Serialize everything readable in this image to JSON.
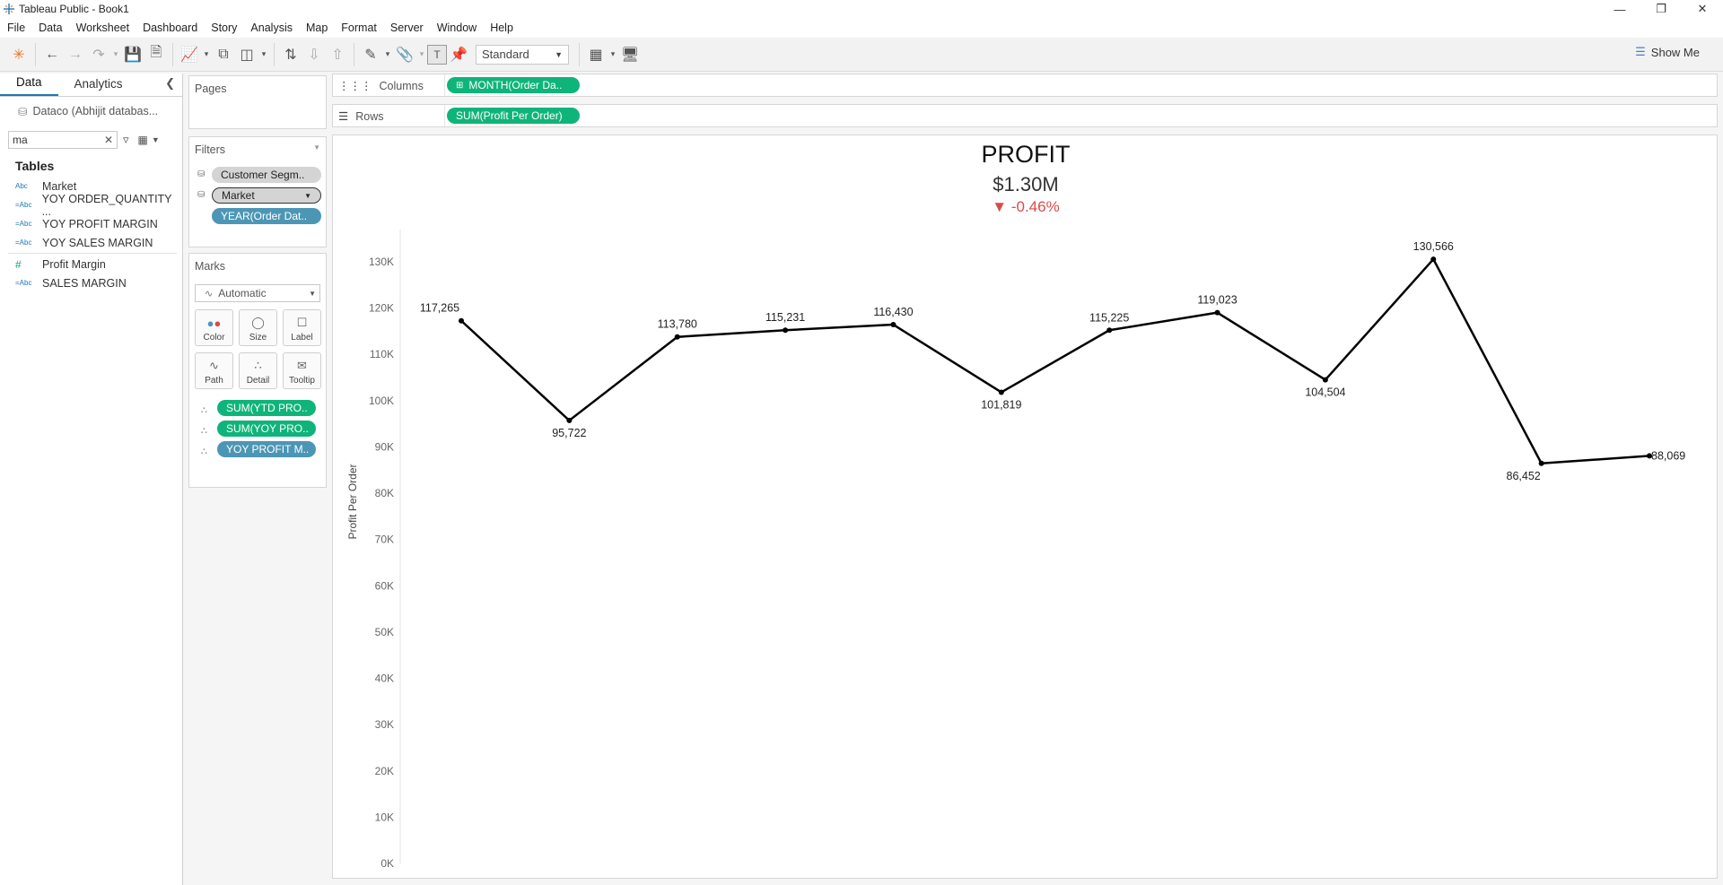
{
  "window": {
    "title": "Tableau Public - Book1"
  },
  "menu": [
    "File",
    "Data",
    "Worksheet",
    "Dashboard",
    "Story",
    "Analysis",
    "Map",
    "Format",
    "Server",
    "Window",
    "Help"
  ],
  "toolbar": {
    "fit_option": "Standard",
    "show_me_label": "Show Me"
  },
  "data_pane": {
    "tabs": [
      "Data",
      "Analytics"
    ],
    "datasource": "Dataco (Abhijit databas...",
    "search_value": "ma",
    "tables_heading": "Tables",
    "fields": [
      {
        "type": "Abc",
        "name": "Market"
      },
      {
        "type": "=Abc",
        "name": "YOY ORDER_QUANTITY ..."
      },
      {
        "type": "=Abc",
        "name": "YOY PROFIT MARGIN"
      },
      {
        "type": "=Abc",
        "name": "YOY SALES MARGIN"
      },
      {
        "type": "#",
        "name": "Profit Margin"
      },
      {
        "type": "=Abc",
        "name": "SALES MARGIN"
      }
    ]
  },
  "pages_card": {
    "title": "Pages"
  },
  "filters_card": {
    "title": "Filters",
    "pills": [
      "Customer Segm..",
      "Market",
      "YEAR(Order Dat.."
    ]
  },
  "marks_card": {
    "title": "Marks",
    "mark_type": "Automatic",
    "buttons": [
      "Color",
      "Size",
      "Label",
      "Path",
      "Detail",
      "Tooltip"
    ],
    "pills": [
      "SUM(YTD PRO..",
      "SUM(YOY PRO..",
      "YOY PROFIT M.."
    ]
  },
  "columns_shelf": {
    "label": "Columns",
    "pill": "MONTH(Order Da.."
  },
  "rows_shelf": {
    "label": "Rows",
    "pill": "SUM(Profit Per Order)"
  },
  "kpi": {
    "title": "PROFIT",
    "value": "$1.30M",
    "delta": "▼ -0.46%",
    "delta_color": "#d94b4b"
  },
  "chart_data": {
    "type": "line",
    "ylabel": "Profit Per Order",
    "ylim": [
      0,
      130000
    ],
    "yticks": [
      "0K",
      "10K",
      "20K",
      "30K",
      "40K",
      "50K",
      "60K",
      "70K",
      "80K",
      "90K",
      "100K",
      "110K",
      "120K",
      "130K"
    ],
    "series": [
      {
        "values": [
          117265,
          95722,
          113780,
          115231,
          116430,
          101819,
          115225,
          119023,
          104504,
          130566,
          86452,
          88069
        ],
        "labels": [
          "117,265",
          "95,722",
          "113,780",
          "115,231",
          "116,430",
          "101,819",
          "115,225",
          "119,023",
          "104,504",
          "130,566",
          "86,452",
          "88,069"
        ]
      }
    ],
    "grid": false,
    "line_color": "#000000"
  },
  "colors": {
    "pill_green": "#0fb47b",
    "pill_blue": "#4c96b5",
    "accent": "#1f77b4"
  }
}
